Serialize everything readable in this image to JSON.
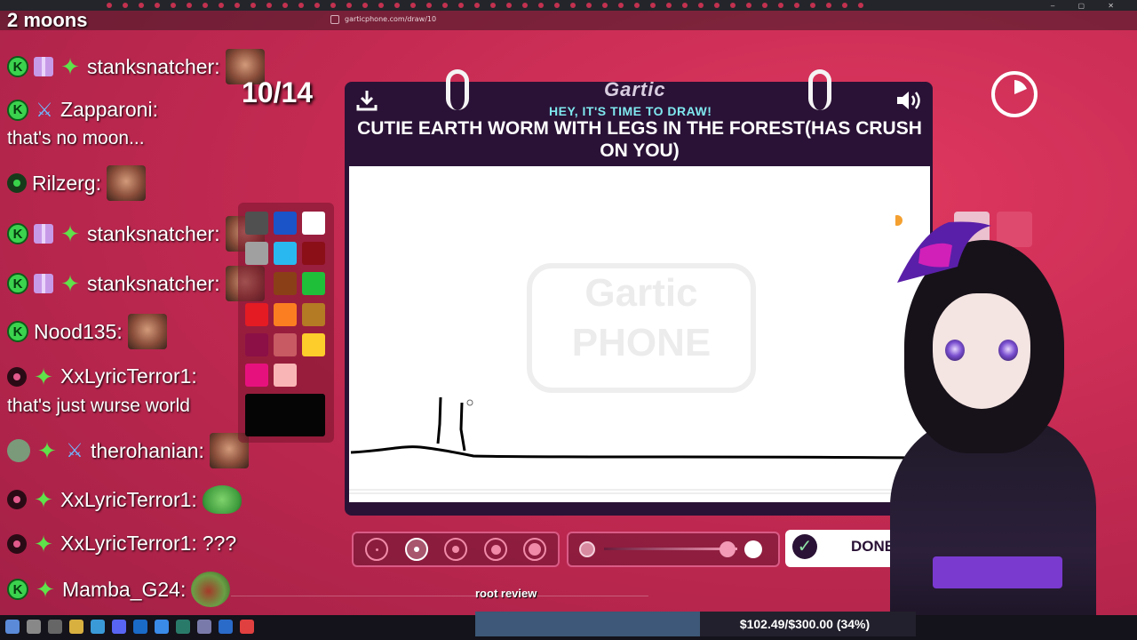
{
  "browser": {
    "url": "garticphone.com/draw/10"
  },
  "chat": {
    "title": "2 moons",
    "messages": [
      {
        "user": "stanksnatcher:",
        "text": ""
      },
      {
        "user": "Zapparoni:",
        "text": "that's no moon..."
      },
      {
        "user": "Rilzerg:",
        "text": ""
      },
      {
        "user": "stanksnatcher:",
        "text": ""
      },
      {
        "user": "stanksnatcher:",
        "text": ""
      },
      {
        "user": "Nood135:",
        "text": ""
      },
      {
        "user": "XxLyricTerror1:",
        "text": "that's just wurse world"
      },
      {
        "user": "therohanian:",
        "text": ""
      },
      {
        "user": "XxLyricTerror1:",
        "text": ""
      },
      {
        "user": "XxLyricTerror1:",
        "text": "???"
      },
      {
        "user": "Mamba_G24:",
        "text": ""
      }
    ]
  },
  "game": {
    "counter": "10/14",
    "logo": "Gartic",
    "subtitle": "HEY, IT'S TIME TO DRAW!",
    "prompt": "CUTIE EARTH WORM WITH LEGS IN THE FOREST(HAS CRUSH ON YOU)",
    "watermark_top": "Gartic",
    "watermark_bottom": "PHONE",
    "done_label": "DONE!"
  },
  "palette": {
    "colors": [
      "#505050",
      "#1a54c8",
      "#ffffff",
      "#a0a0a0",
      "#2ab8f0",
      "#8a0f17",
      "#8b3f17",
      "#1fbf3a",
      "#e41b23",
      "#fb7f20",
      "#b57a24",
      "#8c1046",
      "#c75a63",
      "#fccd2b",
      "#e7117e",
      "#f9b5b5"
    ],
    "selected": "#050505"
  },
  "stream": {
    "review_text": "root review",
    "goal_text": "$102.49/$300.00 (34%)",
    "goal_fraction": 0.34
  },
  "icons": {
    "download": "download-icon",
    "volume": "volume-icon",
    "timer": "timer-icon",
    "pen": "pen-icon",
    "eraser": "eraser-icon",
    "check": "check-icon"
  }
}
